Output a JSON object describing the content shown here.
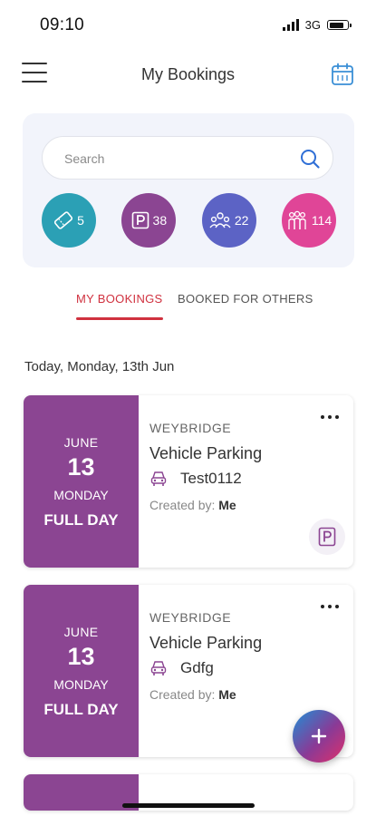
{
  "status_bar": {
    "time": "09:10",
    "network": "3G"
  },
  "header": {
    "title": "My Bookings"
  },
  "search": {
    "placeholder": "Search"
  },
  "filters": [
    {
      "icon": "ticket-icon",
      "count": "5",
      "color": "#2ba0b5"
    },
    {
      "icon": "parking-icon",
      "count": "38",
      "color": "#8b4592"
    },
    {
      "icon": "people-icon",
      "count": "22",
      "color": "#5c63c5"
    },
    {
      "icon": "group-icon",
      "count": "114",
      "color": "#e04597"
    }
  ],
  "tabs": {
    "mine": "MY BOOKINGS",
    "others": "BOOKED FOR OTHERS",
    "active": "mine"
  },
  "date_heading": "Today, Monday, 13th Jun",
  "bookings": [
    {
      "month": "JUNE",
      "day": "13",
      "weekday": "MONDAY",
      "duration": "FULL DAY",
      "location": "WEYBRIDGE",
      "type": "Vehicle Parking",
      "vehicle": "Test0112",
      "created_label": "Created by:",
      "created_by": "Me",
      "badge_icon": "parking-icon"
    },
    {
      "month": "JUNE",
      "day": "13",
      "weekday": "MONDAY",
      "duration": "FULL DAY",
      "location": "WEYBRIDGE",
      "type": "Vehicle Parking",
      "vehicle": "Gdfg",
      "created_label": "Created by:",
      "created_by": "Me"
    }
  ],
  "colors": {
    "accent": "#d0313f",
    "card_date_bg": "#8b4592",
    "filter_card_bg": "#f2f4fb"
  }
}
